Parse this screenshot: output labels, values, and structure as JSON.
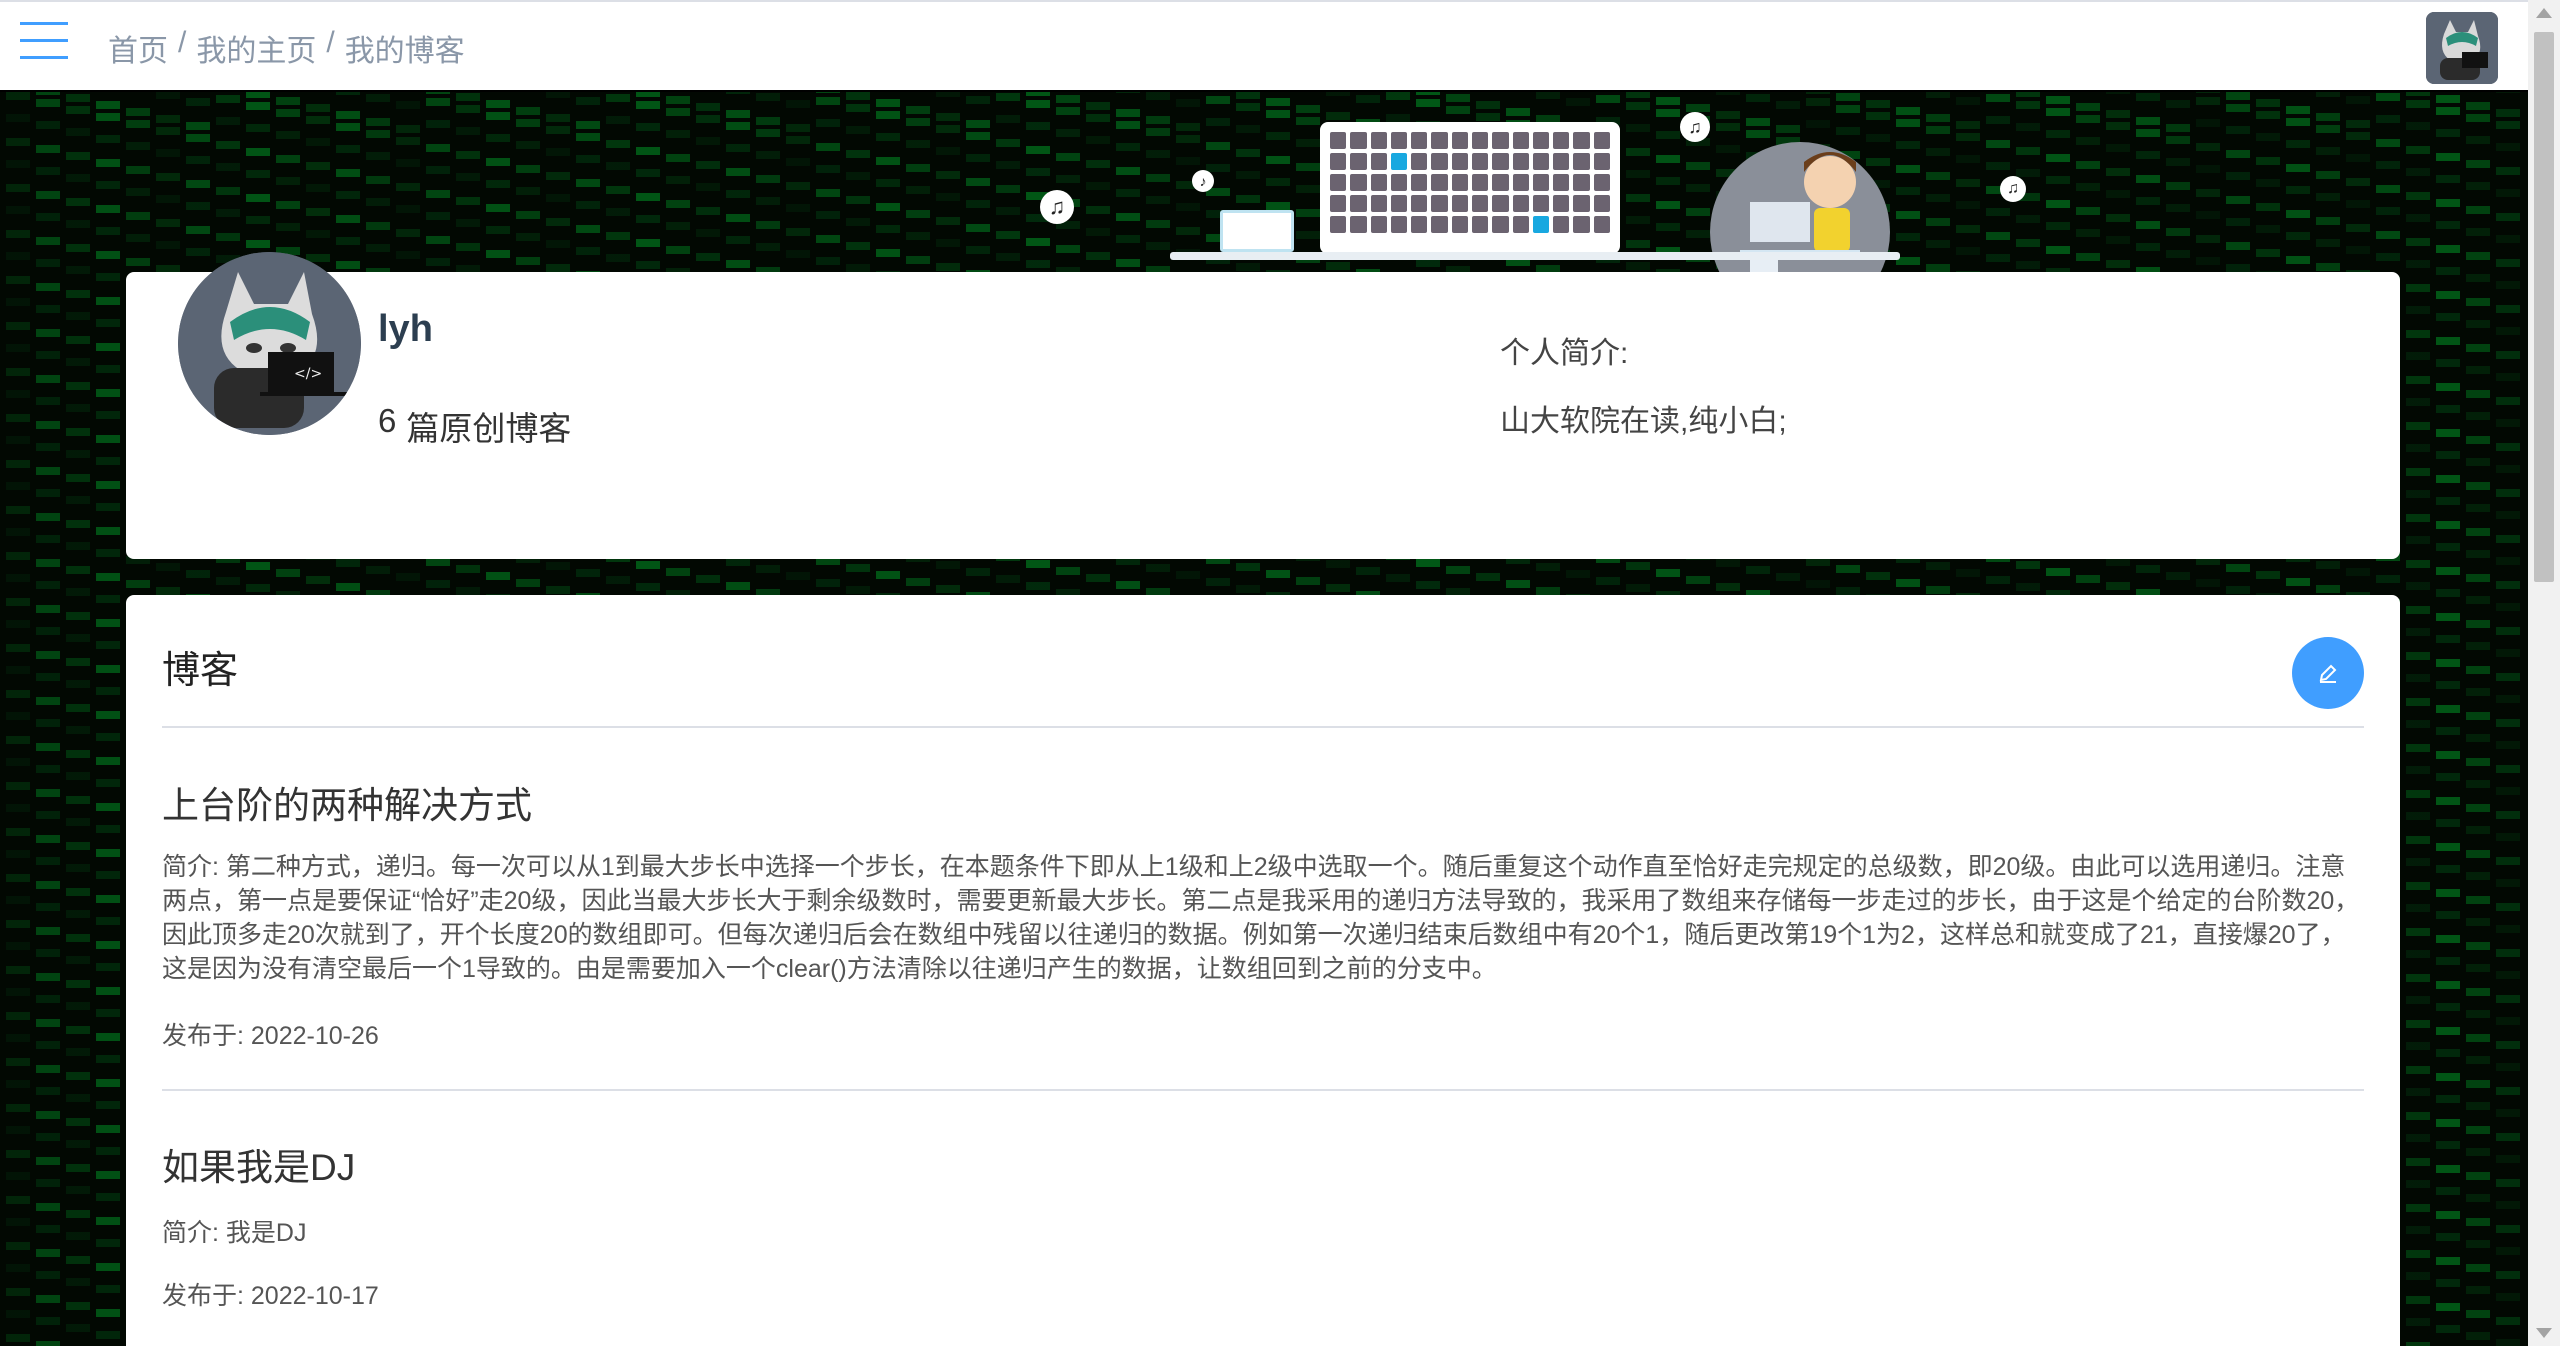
{
  "breadcrumb": [
    {
      "label": "首页"
    },
    {
      "label": "我的主页"
    },
    {
      "label": "我的博客"
    }
  ],
  "breadcrumb_separator": "/",
  "profile": {
    "username": "lyh",
    "blog_count": "6",
    "blog_count_suffix": "篇原创博客",
    "intro_label": "个人简介:",
    "intro_text": "山大软院在读,纯小白;"
  },
  "blog_section": {
    "title": "博客",
    "edit_icon": "pencil-icon",
    "posts": [
      {
        "title": "上台阶的两种解决方式",
        "summary": "简介: 第二种方式，递归。每一次可以从1到最大步长中选择一个步长，在本题条件下即从上1级和上2级中选取一个。随后重复这个动作直至恰好走完规定的总级数，即20级。由此可以选用递归。注意两点，第一点是要保证“恰好”走20级，因此当最大步长大于剩余级数时，需要更新最大步长。第二点是我采用的递归方法导致的，我采用了数组来存储每一步走过的步长，由于这是个给定的台阶数20，因此顶多走20次就到了，开个长度20的数组即可。但每次递归后会在数组中残留以往递归的数据。例如第一次递归结束后数组中有20个1，随后更改第19个1为2，这样总和就变成了21，直接爆20了，这是因为没有清空最后一个1导致的。由是需要加入一个clear()方法清除以往递归产生的数据，让数组回到之前的分支中。",
        "date": "发布于: 2022-10-26"
      },
      {
        "title": "如果我是DJ",
        "summary": "简介: 我是DJ",
        "date": "发布于: 2022-10-17"
      }
    ]
  },
  "colors": {
    "accent": "#409eff",
    "matrix_green": "#00a028",
    "breadcrumb": "#8a97a8"
  },
  "icons": {
    "menu": "hamburger-menu-icon",
    "note": "music-note-icon"
  }
}
